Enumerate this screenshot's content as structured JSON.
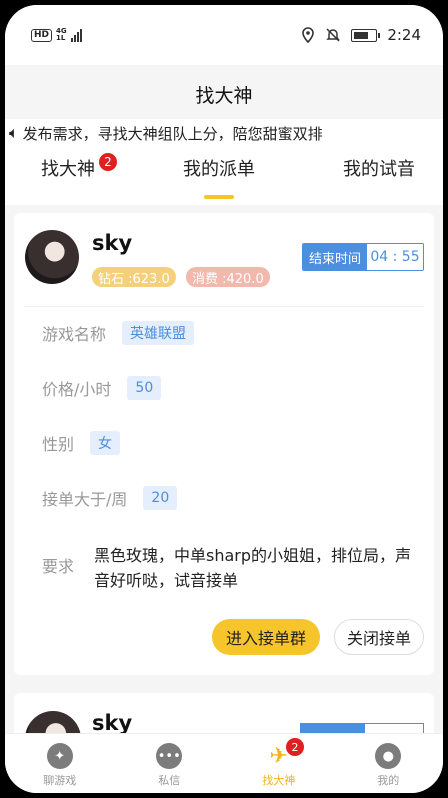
{
  "status": {
    "hd": "HD",
    "net": "4G",
    "net_sub": "1L",
    "time": "2:24"
  },
  "header": {
    "title": "找大神"
  },
  "notice": {
    "text": "发布需求，寻找大神组队上分，陪您甜蜜双排"
  },
  "tabs": [
    {
      "label": "找大神",
      "badge": "2"
    },
    {
      "label": "我的派单",
      "active": true
    },
    {
      "label": "我的试音"
    }
  ],
  "order": {
    "username": "sky",
    "diamond": "钻石 :623.0",
    "spend": "消费 :420.0",
    "end_time_label": "结束时间",
    "end_time": "04 : 55",
    "fields": {
      "game_label": "游戏名称",
      "game_value": "英雄联盟",
      "price_label": "价格/小时",
      "price_value": "50",
      "gender_label": "性别",
      "gender_value": "女",
      "weekly_label": "接单大于/周",
      "weekly_value": "20",
      "req_label": "要求",
      "req_value": "黑色玫瑰，中单sharp的小姐姐，排位局，声音好听哒，试音接单"
    },
    "join_button": "进入接单群",
    "close_button": "关闭接单"
  },
  "order2": {
    "username": "sky"
  },
  "bottom_nav": [
    {
      "label": "聊游戏",
      "icon": "chat-game-icon"
    },
    {
      "label": "私信",
      "icon": "message-icon"
    },
    {
      "label": "找大神",
      "icon": "plane-icon",
      "badge": "2",
      "active": true
    },
    {
      "label": "我的",
      "icon": "user-icon"
    }
  ],
  "colors": {
    "accent": "#f6c42b",
    "blue": "#4a8fe0",
    "badge": "#e02020"
  }
}
